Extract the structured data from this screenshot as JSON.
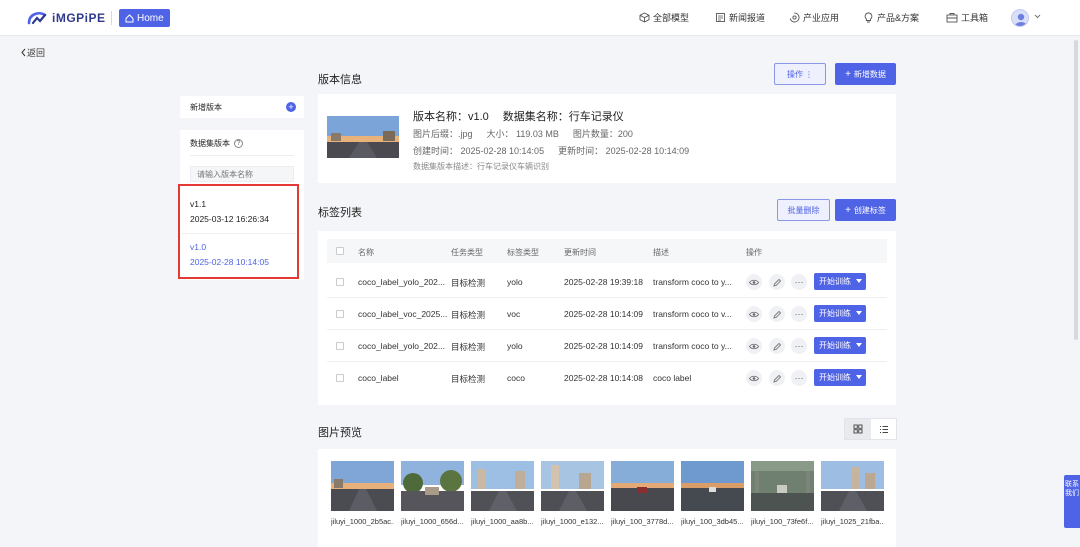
{
  "header": {
    "logo_text": "iMGPiPE",
    "home_label": "Home",
    "nav": [
      {
        "label": "全部模型",
        "icon": "cube-icon"
      },
      {
        "label": "新闻报道",
        "icon": "news-icon"
      },
      {
        "label": "产业应用",
        "icon": "industry-icon"
      },
      {
        "label": "产品&方案",
        "icon": "bulb-icon"
      },
      {
        "label": "工具箱",
        "icon": "toolbox-icon"
      }
    ]
  },
  "back_label": "返回",
  "sidebar": {
    "new_version_label": "新增版本",
    "versions_title": "数据集版本",
    "search_placeholder": "请输入版本名称",
    "versions": [
      {
        "name": "v1.1",
        "time": "2025-03-12 16:26:34",
        "active": false
      },
      {
        "name": "v1.0",
        "time": "2025-02-28 10:14:05",
        "active": true
      }
    ]
  },
  "version_info": {
    "title": "版本信息",
    "ops_button": "操作",
    "add_data_button": "新增数据",
    "version_name": "版本名称：v1.0",
    "dataset_name": "数据集名称：行车记录仪",
    "ext": "图片后缀：.jpg",
    "size": "大小：  119.03 MB",
    "count": "图片数量：200",
    "created": "创建时间：  2025-02-28 10:14:05",
    "updated": "更新时间：  2025-02-28 10:14:09",
    "description": "数据集版本描述：行车记录仪车辆识别"
  },
  "tag_list": {
    "title": "标签列表",
    "batch_delete": "批量删除",
    "create_tag": "创建标签",
    "columns": [
      "名称",
      "任务类型",
      "标签类型",
      "更新时间",
      "描述",
      "操作"
    ],
    "train_label": "开始训练",
    "rows": [
      {
        "name": "coco_label_yolo_202...",
        "task": "目标检测",
        "type": "yolo",
        "time": "2025-02-28 19:39:18",
        "desc": "transform coco to y..."
      },
      {
        "name": "coco_label_voc_2025...",
        "task": "目标检测",
        "type": "voc",
        "time": "2025-02-28 10:14:09",
        "desc": "transform coco to v..."
      },
      {
        "name": "coco_label_yolo_202...",
        "task": "目标检测",
        "type": "yolo",
        "time": "2025-02-28 10:14:09",
        "desc": "transform coco to y..."
      },
      {
        "name": "coco_label",
        "task": "目标检测",
        "type": "coco",
        "time": "2025-02-28 10:14:08",
        "desc": "coco label"
      }
    ]
  },
  "preview": {
    "title": "图片预览",
    "images": [
      "jiluyi_1000_2b5ac...",
      "jiluyi_1000_656d...",
      "jiluyi_1000_aa8b...",
      "jiluyi_1000_e132...",
      "jiluyi_100_3778d...",
      "jiluyi_100_3db45...",
      "jiluyi_100_73fe6f...",
      "jiluyi_1025_21fba..."
    ]
  },
  "contact_label": "联系我们"
}
